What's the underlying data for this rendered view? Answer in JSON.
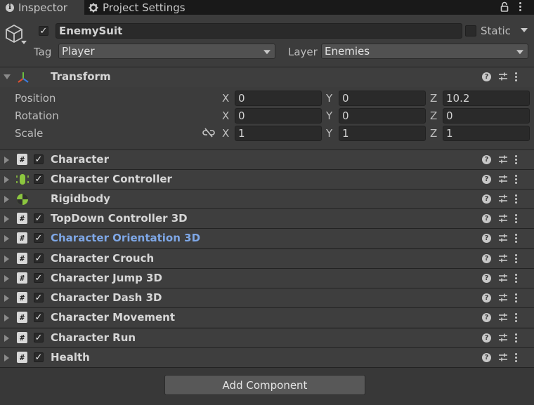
{
  "tabs": [
    {
      "label": "Inspector",
      "icon": "info-icon",
      "active": true
    },
    {
      "label": "Project Settings",
      "icon": "gear-icon",
      "active": false
    }
  ],
  "object": {
    "name": "EnemySuit",
    "active": true,
    "static_label": "Static",
    "tag_label": "Tag",
    "tag_value": "Player",
    "layer_label": "Layer",
    "layer_value": "Enemies"
  },
  "transform": {
    "title": "Transform",
    "rows": [
      {
        "label": "Position",
        "x": "0",
        "y": "0",
        "z": "10.2"
      },
      {
        "label": "Rotation",
        "x": "0",
        "y": "0",
        "z": "0"
      },
      {
        "label": "Scale",
        "x": "1",
        "y": "1",
        "z": "1"
      }
    ],
    "axis": {
      "x": "X",
      "y": "Y",
      "z": "Z"
    }
  },
  "components": [
    {
      "title": "Character",
      "icon": "script-icon",
      "enabled": true,
      "highlight": false
    },
    {
      "title": "Character Controller",
      "icon": "character-controller-icon",
      "enabled": true,
      "highlight": false
    },
    {
      "title": "Rigidbody",
      "icon": "rigidbody-icon",
      "enabled": null,
      "highlight": false
    },
    {
      "title": "TopDown Controller 3D",
      "icon": "script-icon",
      "enabled": true,
      "highlight": false
    },
    {
      "title": "Character Orientation 3D",
      "icon": "script-icon",
      "enabled": true,
      "highlight": true
    },
    {
      "title": "Character Crouch",
      "icon": "script-icon",
      "enabled": true,
      "highlight": false
    },
    {
      "title": "Character Jump 3D",
      "icon": "script-icon",
      "enabled": true,
      "highlight": false
    },
    {
      "title": "Character Dash 3D",
      "icon": "script-icon",
      "enabled": true,
      "highlight": false
    },
    {
      "title": "Character Movement",
      "icon": "script-icon",
      "enabled": true,
      "highlight": false
    },
    {
      "title": "Character Run",
      "icon": "script-icon",
      "enabled": true,
      "highlight": false
    },
    {
      "title": "Health",
      "icon": "script-icon",
      "enabled": true,
      "highlight": false
    }
  ],
  "add_component_label": "Add Component",
  "colors": {
    "background": "#383838",
    "tabbar": "#191919",
    "highlight_text": "#7ea7e6",
    "field": "#2a2a2a"
  }
}
